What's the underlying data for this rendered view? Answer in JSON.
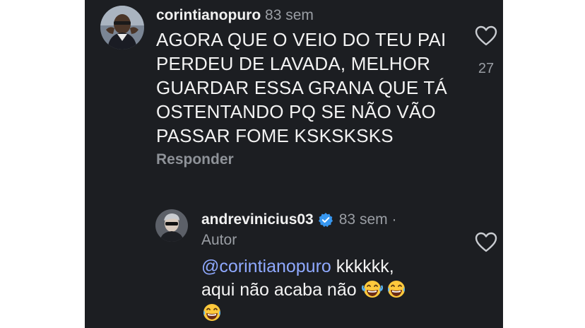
{
  "comment": {
    "username": "corintianopuro",
    "time": "83 sem",
    "lines": [
      "AGORA QUE O VEIO DO TEU PAI",
      "PERDEU DE LAVADA, MELHOR",
      "GUARDAR ESSA GRANA QUE TÁ",
      "OSTENTANDO PQ SE NÃO VÃO",
      "PASSAR FOME KSKSKSKS"
    ],
    "reply_label": "Responder",
    "like_count": "27",
    "like_icon": "heart-outline-icon"
  },
  "reply": {
    "username": "andrevinicius03",
    "verified_icon": "verified-badge-icon",
    "time": "83 sem ·",
    "author_label": "Autor",
    "mention": "@corintianopuro",
    "line1_rest": " kkkkkk,",
    "line2": "aqui não acaba não ",
    "emoji": "face-with-tears-of-joy",
    "like_icon": "heart-outline-icon"
  },
  "colors": {
    "panel": "#1c1e22",
    "text": "#f3f3f3",
    "muted": "#9a9ea4",
    "mention": "#8fa9ff",
    "verified": "#3797f0"
  }
}
